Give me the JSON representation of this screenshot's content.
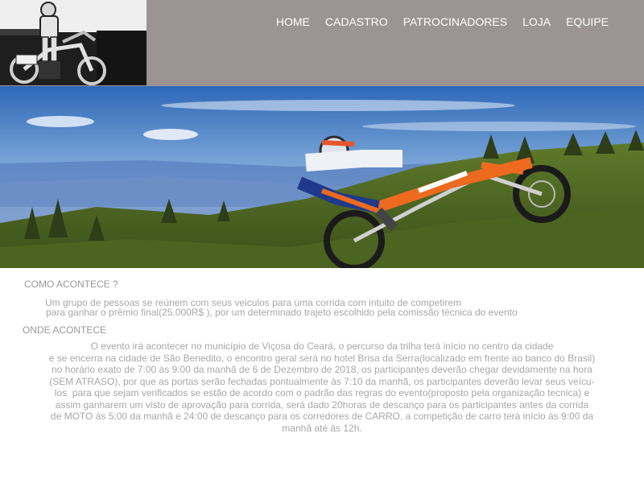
{
  "nav": {
    "items": [
      "HOME",
      "CADASTRO",
      "PATROCINADORES",
      "LOJA",
      "EQUIPE"
    ]
  },
  "colors": {
    "header_bg": "#9c9393",
    "nav_text": "#ffffff",
    "body_text": "#a8a8a8"
  },
  "logo": {
    "icon": "motocross-rider-logo"
  },
  "hero": {
    "icon": "motocross-hero-image"
  },
  "sections": {
    "como": {
      "title": "COMO ACONTECE ?",
      "lines": [
        "Um grupo de pessoas se reúnem com seus veiculos para uma corrida com intuito de competirem",
        "para ganhar o prêmio final(25.000R$ ), por um determinado trajeto escolhido pela comissão técnica do evento"
      ]
    },
    "onde": {
      "title": "ONDE ACONTECE",
      "lines": [
        "O evento irá acontecer no município de Viçosa do Ceará, o percurso da trilha terá início no centro da cidade",
        "e se encerra na cidade de São Benedito, o encontro geral será no hotel Brisa da Serra(localizado em frente ao banco do Brasil)",
        "no horário exato de 7:00 às 9:00 da manhã de 6 de Dezembro de 2018, os participantes deverão chegar devidamente na hora",
        "(SEM ATRASO), por que as portas serão fechadas pontualmente às 7:10 da manhã, os participantes deverão levar seus veícu-",
        "los  para que sejam verificados se estão de acordo com o padrão das regras do evento(proposto pela organização tecnica) e",
        "assim ganharem um visto de aprovação para corrida, será dado 20horas de descanço para os participantes antes da corrida",
        "de MOTO às 5:00 da manhã e 24:00 de descanço para os corredores de CARRO, a competição de carro terá início às 9:00 da",
        "manhã até às 12h."
      ]
    }
  }
}
